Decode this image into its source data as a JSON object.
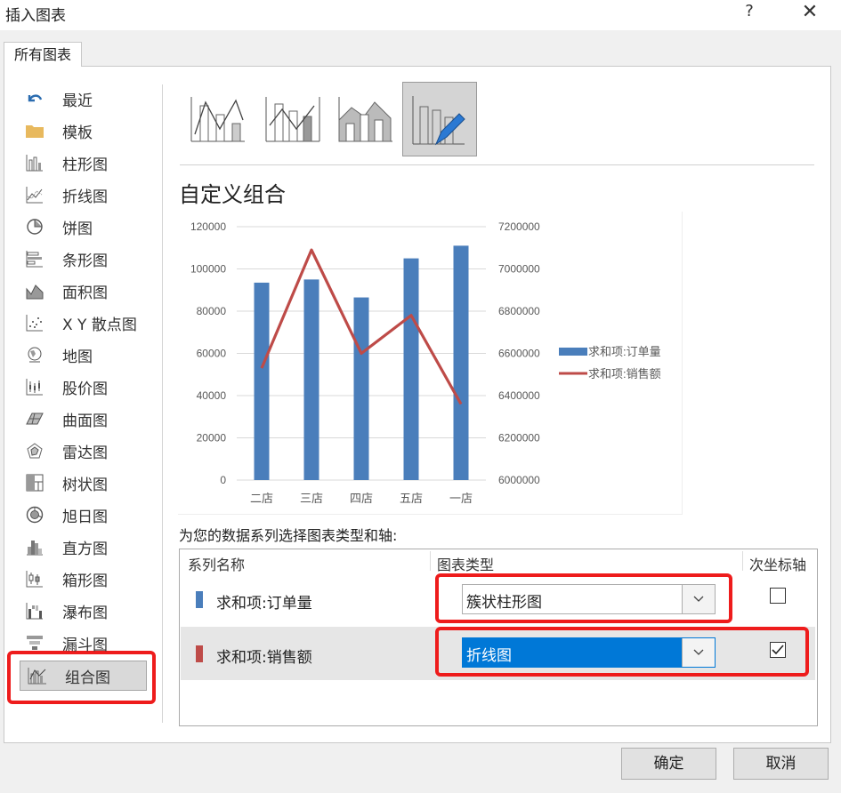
{
  "window": {
    "title": "插入图表",
    "help": "?",
    "close": "✕"
  },
  "tab": {
    "label": "所有图表"
  },
  "sidebar": {
    "items": [
      {
        "label": "最近",
        "icon": "recent-icon"
      },
      {
        "label": "模板",
        "icon": "folder-icon"
      },
      {
        "label": "柱形图",
        "icon": "column-chart-icon"
      },
      {
        "label": "折线图",
        "icon": "line-chart-icon"
      },
      {
        "label": "饼图",
        "icon": "pie-chart-icon"
      },
      {
        "label": "条形图",
        "icon": "bar-chart-icon"
      },
      {
        "label": "面积图",
        "icon": "area-chart-icon"
      },
      {
        "label": "X Y 散点图",
        "icon": "scatter-chart-icon"
      },
      {
        "label": "地图",
        "icon": "map-chart-icon"
      },
      {
        "label": "股价图",
        "icon": "stock-chart-icon"
      },
      {
        "label": "曲面图",
        "icon": "surface-chart-icon"
      },
      {
        "label": "雷达图",
        "icon": "radar-chart-icon"
      },
      {
        "label": "树状图",
        "icon": "treemap-chart-icon"
      },
      {
        "label": "旭日图",
        "icon": "sunburst-chart-icon"
      },
      {
        "label": "直方图",
        "icon": "histogram-chart-icon"
      },
      {
        "label": "箱形图",
        "icon": "boxwhisker-chart-icon"
      },
      {
        "label": "瀑布图",
        "icon": "waterfall-chart-icon"
      },
      {
        "label": "漏斗图",
        "icon": "funnel-chart-icon"
      },
      {
        "label": "组合图",
        "icon": "combo-chart-icon"
      }
    ],
    "selected": "组合图"
  },
  "main": {
    "subtype_title": "自定义组合",
    "series_caption": "为您的数据系列选择图表类型和轴:",
    "table": {
      "headers": [
        "系列名称",
        "图表类型",
        "次坐标轴"
      ],
      "rows": [
        {
          "name": "求和项:订单量",
          "color": "#4a7ebb",
          "chart_type": "簇状柱形图",
          "secondary_axis": false
        },
        {
          "name": "求和项:销售额",
          "color": "#be4b48",
          "chart_type": "折线图",
          "secondary_axis": true
        }
      ]
    }
  },
  "buttons": {
    "ok": "确定",
    "cancel": "取消"
  },
  "colors": {
    "accent": "#0078d7",
    "highlight": "#ee1c1c",
    "bar": "#4a7ebb",
    "line": "#be4b48"
  },
  "chart_data": {
    "type": "bar",
    "categories": [
      "二店",
      "三店",
      "四店",
      "五店",
      "一店"
    ],
    "series": [
      {
        "name": "求和项:订单量",
        "type": "bar",
        "axis": "primary",
        "values": [
          93500,
          95000,
          86500,
          105000,
          111000
        ]
      },
      {
        "name": "求和项:销售额",
        "type": "line",
        "axis": "secondary",
        "values": [
          6530000,
          7090000,
          6600000,
          6780000,
          6360000
        ]
      }
    ],
    "y_ticks": [
      "0",
      "20000",
      "40000",
      "60000",
      "80000",
      "100000",
      "120000"
    ],
    "y2_ticks": [
      "6000000",
      "6200000",
      "6400000",
      "6600000",
      "6800000",
      "7000000",
      "7200000"
    ],
    "ylim": [
      0,
      120000
    ],
    "y2lim": [
      6000000,
      7200000
    ],
    "legend": "right",
    "grid": true
  }
}
